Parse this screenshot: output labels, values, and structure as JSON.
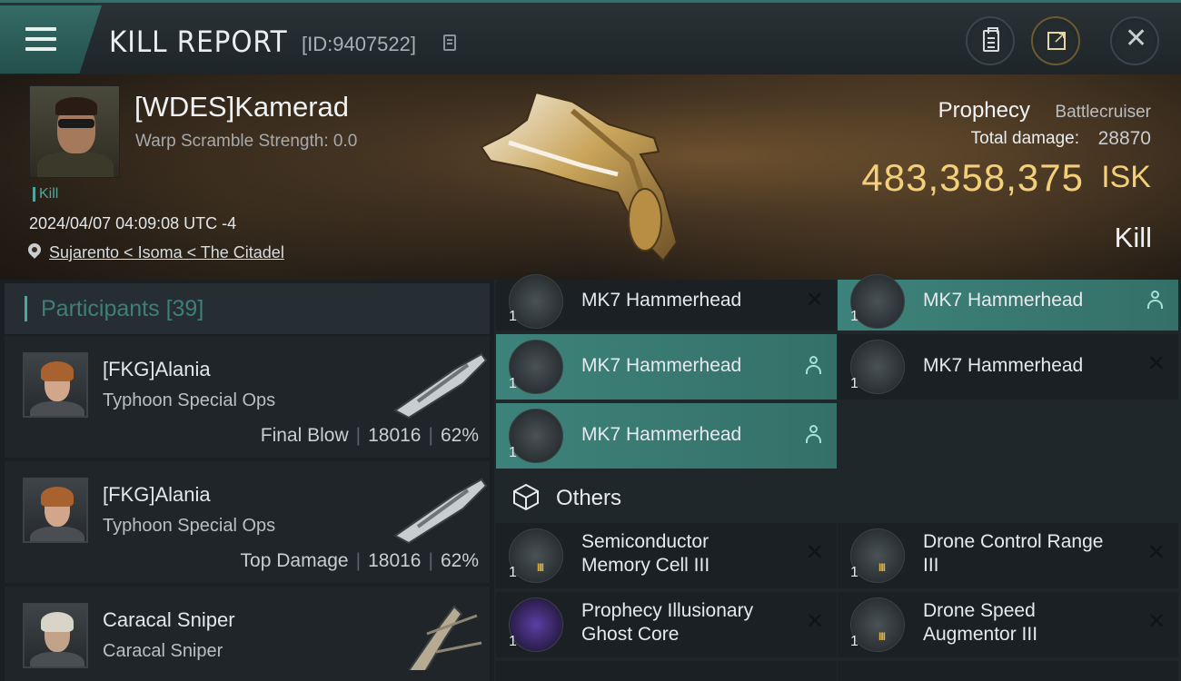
{
  "header": {
    "title": "KILL REPORT",
    "report_id": "[ID:9407522]"
  },
  "victim": {
    "name": "[WDES]Kamerad",
    "warp_scramble": "Warp Scramble Strength: 0.0",
    "tag": "Kill",
    "datetime": "2024/04/07 04:09:08 UTC -4",
    "location": "Sujarento < Isoma < The Citadel",
    "ship_name": "Prophecy",
    "ship_class": "Battlecruiser",
    "total_damage_label": "Total damage:",
    "total_damage": "28870",
    "isk_value": "483,358,375",
    "isk_unit": "ISK",
    "result": "Kill"
  },
  "participants": {
    "label": "Participants",
    "count": "[39]",
    "list": [
      {
        "name": "[FKG]Alania",
        "ship": "Typhoon Special Ops",
        "role": "Final Blow",
        "damage": "18016",
        "percent": "62%"
      },
      {
        "name": "[FKG]Alania",
        "ship": "Typhoon Special Ops",
        "role": "Top Damage",
        "damage": "18016",
        "percent": "62%"
      },
      {
        "name": "Caracal Sniper",
        "ship": "Caracal Sniper"
      }
    ]
  },
  "drones": [
    {
      "qty": "1",
      "name": "MK7  Hammerhead",
      "status": "destroyed"
    },
    {
      "qty": "1",
      "name": "MK7  Hammerhead",
      "status": "dropped"
    },
    {
      "qty": "1",
      "name": "MK7  Hammerhead",
      "status": "dropped"
    },
    {
      "qty": "1",
      "name": "MK7  Hammerhead",
      "status": "destroyed"
    },
    {
      "qty": "1",
      "name": "MK7  Hammerhead",
      "status": "dropped"
    }
  ],
  "others": {
    "label": "Others",
    "items": [
      {
        "qty": "1",
        "name_line1": "Semiconductor",
        "name_line2": "Memory Cell III",
        "status": "destroyed"
      },
      {
        "qty": "1",
        "name_line1": "Drone Control Range",
        "name_line2": "III",
        "status": "destroyed"
      },
      {
        "qty": "1",
        "name_line1": "Prophecy Illusionary",
        "name_line2": "Ghost Core",
        "status": "destroyed"
      },
      {
        "qty": "1",
        "name_line1": "Drone Speed",
        "name_line2": "Augmentor III",
        "status": "destroyed"
      }
    ]
  },
  "colors": {
    "accent_teal": "#3d837b",
    "isk_gold": "#f3cf7a",
    "tier_gold": "#d9b24a"
  }
}
